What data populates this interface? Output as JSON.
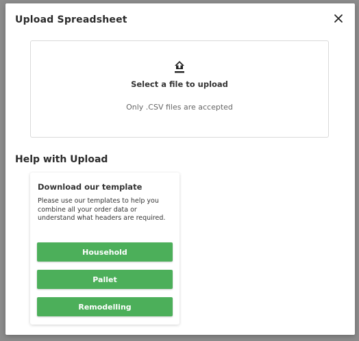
{
  "modal": {
    "title": "Upload Spreadsheet"
  },
  "dropzone": {
    "title": "Select a file to upload",
    "subtitle": "Only .CSV files are accepted"
  },
  "help": {
    "title": "Help with Upload",
    "card_title": "Download our template",
    "card_description": "Please use our templates to help you combine all your order data or understand what headers are required.",
    "buttons": [
      {
        "label": "Household"
      },
      {
        "label": "Pallet"
      },
      {
        "label": "Remodelling"
      }
    ]
  },
  "colors": {
    "button_green": "#4caf5a",
    "backdrop": "#8c8c8c"
  },
  "icons": {
    "close": "close-icon",
    "upload": "upload-icon"
  }
}
